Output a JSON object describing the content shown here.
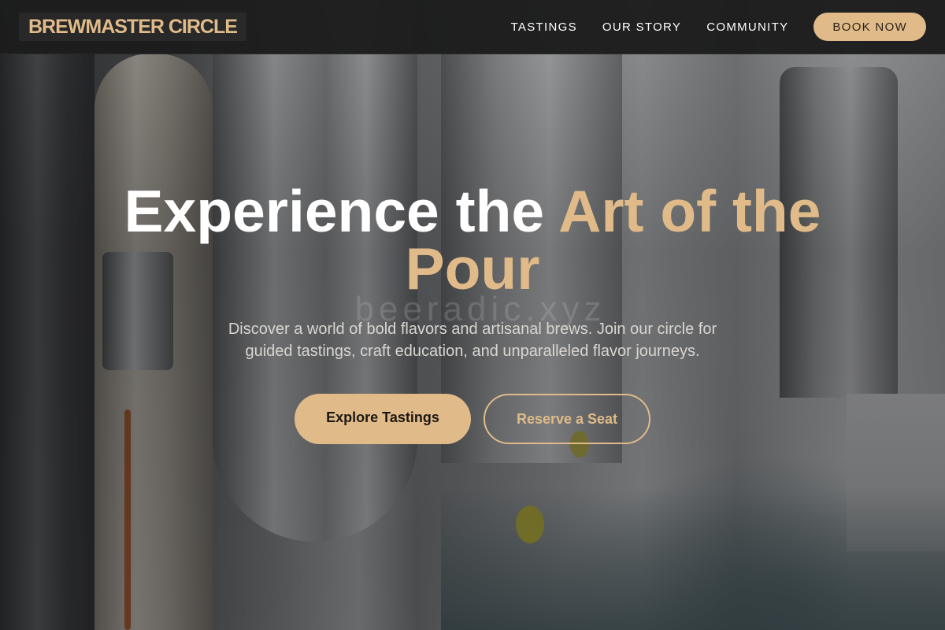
{
  "nav": {
    "brand": "BREWMASTER CIRCLE",
    "links": [
      "TASTINGS",
      "OUR STORY",
      "COMMUNITY"
    ],
    "cta": "BOOK NOW"
  },
  "hero": {
    "headline_part1": "Experience the ",
    "headline_accent": "Art of the Pour",
    "watermark": "beeradic.xyz",
    "subtitle": "Discover a world of bold flavors and artisanal brews. Join our circle for guided tastings, craft education, and unparalleled flavor journeys.",
    "primary_cta": "Explore Tastings",
    "secondary_cta": "Reserve a Seat"
  },
  "colors": {
    "accent": "#e0bb89",
    "navbar": "#1c1c1c",
    "text_light": "#ffffff"
  }
}
